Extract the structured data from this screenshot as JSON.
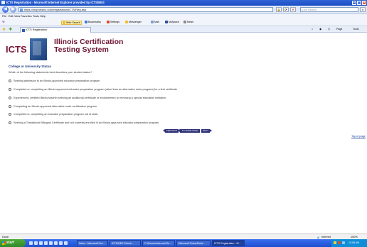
{
  "window": {
    "title": "ICTS Registration - Microsoft Internet Explorer provided by ICTS/NES"
  },
  "nav": {
    "back_label": "◀",
    "forward_label": "▶",
    "address": "https://regi.nesinc.com/registration/ICTS/Reg.asp",
    "refresh_label": "⟳",
    "stop_label": "✕",
    "search_placeholder": "Live Search"
  },
  "menu": [
    "File",
    "Edit",
    "View",
    "Favorites",
    "Tools",
    "Help"
  ],
  "toolbar": {
    "web_search": "Web Search",
    "bookmarks": "Bookmarks",
    "settings": "Settings",
    "messenger": "Messenger",
    "mail": "Mail",
    "myspace": "MySpace",
    "news": "News"
  },
  "tab": {
    "label": "ICTS Registration"
  },
  "tab_tools": {
    "home": "⌂",
    "feeds": "◉",
    "print": "⎙",
    "page": "Page",
    "tools": "Tools"
  },
  "logo": {
    "text": "ICTS"
  },
  "page": {
    "heading_line1": "Illinois Certification",
    "heading_line2": "Testing System",
    "section_title": "College or University Status",
    "question": "Which of the following statements best describes your student status?",
    "options": [
      "Seeking admission to an Illinois-approved educator preparation program",
      "Completed or completing an Illinois-approved educator preparation program (other than an alternative route program) for a first certificate",
      "Experienced, certified Illinois teacher seeking an additional certificate or endorsement or removing a special education limitation",
      "Completing an Illinois-approved alternative route certification program",
      "Completed or completing an educator preparation program out of state",
      "Seeking a Transitional Bilingual Certificate and not currently enrolled in an Illinois-approved educator preparation program"
    ],
    "buttons": {
      "previous": "PREVIOUS",
      "to_home_page": "TO HOME PAGE",
      "next": "NEXT"
    },
    "top_of_page": "Top of page"
  },
  "status": {
    "left": "Done",
    "zone": "Internet",
    "zoom": "100%"
  },
  "taskbar": {
    "start": "start",
    "buttons": [
      "Inbox - Microsoft Out...",
      "ICTS/NES Check...",
      "C:\\Documents and Se...",
      "Microsoft PowerPoint...",
      "ICTS Registration - M..."
    ],
    "clock": "10:58 AM"
  }
}
